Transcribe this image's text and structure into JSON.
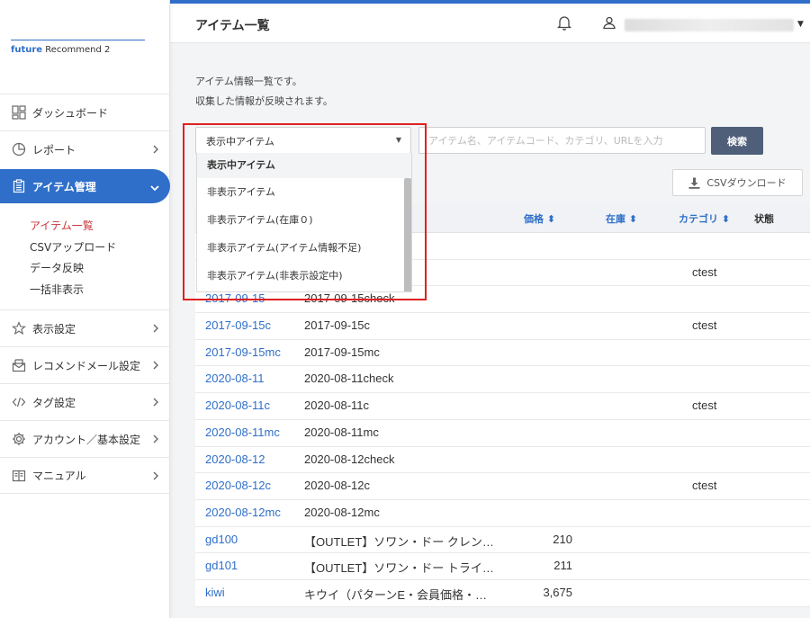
{
  "brand": {
    "part1": "future",
    "part2": "Recommend 2"
  },
  "sidebar": {
    "items": [
      {
        "label": "ダッシュボード",
        "icon": "dashboard-icon"
      },
      {
        "label": "レポート",
        "icon": "pie-chart-icon"
      },
      {
        "label": "アイテム管理",
        "icon": "clipboard-icon",
        "active": true
      },
      {
        "label": "表示設定",
        "icon": "star-icon"
      },
      {
        "label": "レコメンドメール設定",
        "icon": "mail-icon"
      },
      {
        "label": "タグ設定",
        "icon": "code-icon"
      },
      {
        "label": "アカウント／基本設定",
        "icon": "gear-icon"
      },
      {
        "label": "マニュアル",
        "icon": "book-icon"
      }
    ],
    "subitems": [
      "アイテム一覧",
      "CSVアップロード",
      "データ反映",
      "一括非表示"
    ]
  },
  "header": {
    "title": "アイテム一覧"
  },
  "main": {
    "desc_line1": "アイテム情報一覧です。",
    "desc_line2": "収集した情報が反映されます。",
    "filter": {
      "selected": "表示中アイテム",
      "options": [
        "表示中アイテム",
        "非表示アイテム",
        "非表示アイテム(在庫０)",
        "非表示アイテム(アイテム情報不足)",
        "非表示アイテム(非表示設定中)"
      ]
    },
    "search_placeholder": "アイテム名、アイテムコード、カテゴリ、URLを入力",
    "search_button": "検索",
    "csv_button": "CSVダウンロード"
  },
  "table": {
    "headers": {
      "price": "価格",
      "stock": "在庫",
      "category": "カテゴリ",
      "status": "状態"
    },
    "rows": [
      {
        "code": "",
        "name": "",
        "price": "",
        "category": ""
      },
      {
        "code": "",
        "name": "",
        "price": "",
        "category": "ctest"
      },
      {
        "code": "2017-09-15",
        "name": "2017-09-15check",
        "price": "",
        "category": ""
      },
      {
        "code": "2017-09-15c",
        "name": "2017-09-15c",
        "price": "",
        "category": "ctest"
      },
      {
        "code": "2017-09-15mc",
        "name": "2017-09-15mc",
        "price": "",
        "category": ""
      },
      {
        "code": "2020-08-11",
        "name": "2020-08-11check",
        "price": "",
        "category": ""
      },
      {
        "code": "2020-08-11c",
        "name": "2020-08-11c",
        "price": "",
        "category": "ctest"
      },
      {
        "code": "2020-08-11mc",
        "name": "2020-08-11mc",
        "price": "",
        "category": ""
      },
      {
        "code": "2020-08-12",
        "name": "2020-08-12check",
        "price": "",
        "category": ""
      },
      {
        "code": "2020-08-12c",
        "name": "2020-08-12c",
        "price": "",
        "category": "ctest"
      },
      {
        "code": "2020-08-12mc",
        "name": "2020-08-12mc",
        "price": "",
        "category": ""
      },
      {
        "code": "gd100",
        "name": "【OUTLET】ソワン・ドー クレン…",
        "price": "210",
        "category": ""
      },
      {
        "code": "gd101",
        "name": "【OUTLET】ソワン・ドー トライ…",
        "price": "211",
        "category": ""
      },
      {
        "code": "kiwi",
        "name": "キウイ（パターンE・会員価格・…",
        "price": "3,675",
        "category": ""
      }
    ]
  },
  "colors": {
    "accent": "#2f6fc9",
    "highlight": "#e02020",
    "search_button": "#4f5f7a",
    "current_subitem": "#c8353a"
  }
}
